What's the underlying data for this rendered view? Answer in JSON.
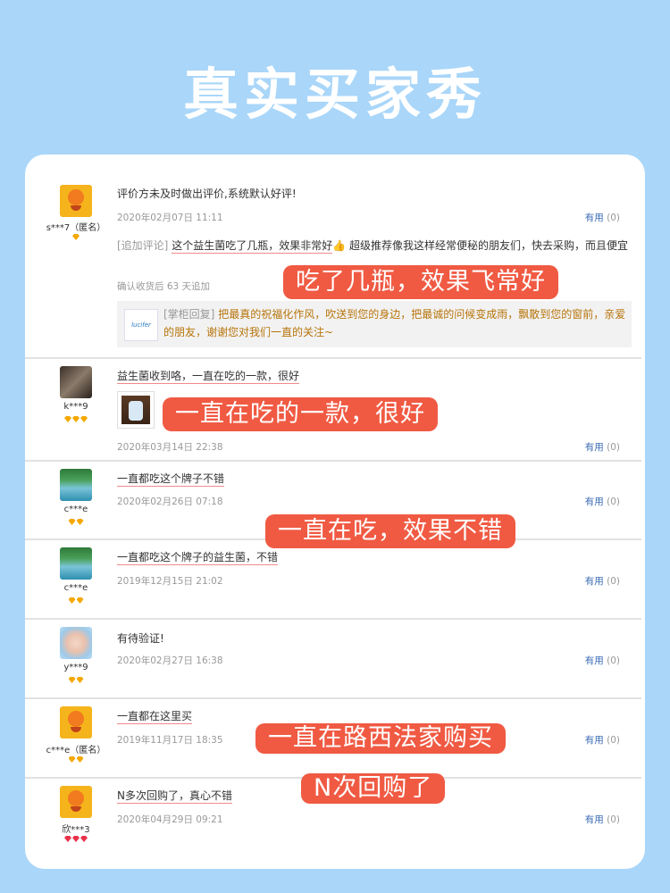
{
  "page": {
    "title": "真实买家秀"
  },
  "reviews": [
    {
      "user": "s***7（匿名）",
      "text": "评价方未及时做出评价,系统默认好评!",
      "date": "2020年02月07日 11:11",
      "useful_label": "有用",
      "useful_count": "(0)",
      "append_tag": "[追加评论]",
      "append_text_underlined": "这个益生菌吃了几瓶，效果非常好",
      "append_text_rest": "超级推荐像我这样经常便秘的朋友们，快去采购，而且便宜",
      "append_meta": "确认收货后 63 天追加",
      "reply_tag": "[掌柜回复]",
      "reply_text": "把最真的祝福化作风，吹送到您的身边，把最诚的问候变成雨，飘散到您的窗前，亲爱的朋友，谢谢您对我们一直的关注~",
      "reply_logo": "lucifer",
      "rank_icons": "gold-gem"
    },
    {
      "user": "k***9",
      "text": "益生菌收到咯，一直在吃的一款，很好",
      "date": "2020年03月14日 22:38",
      "useful_label": "有用",
      "useful_count": "(0)"
    },
    {
      "user": "c***e",
      "text": "一直都吃这个牌子不错",
      "date": "2020年02月26日 07:18",
      "useful_label": "有用",
      "useful_count": "(0)"
    },
    {
      "user": "c***e",
      "text": "一直都吃这个牌子的益生菌，不错",
      "date": "2019年12月15日 21:02",
      "useful_label": "有用",
      "useful_count": "(0)"
    },
    {
      "user": "y***9",
      "text": "有待验证!",
      "date": "2020年02月27日 16:38",
      "useful_label": "有用",
      "useful_count": "(0)"
    },
    {
      "user": "c***e（匿名）",
      "text": "一直都在这里买",
      "date": "2019年11月17日 18:35",
      "useful_label": "有用",
      "useful_count": "(0)"
    },
    {
      "user": "欣***3",
      "text": "N多次回购了，真心不错",
      "date": "2020年04月29日 09:21",
      "useful_label": "有用",
      "useful_count": "(0)",
      "rank_icons": "red-gem"
    }
  ],
  "callouts": {
    "c1": "吃了几瓶，效果飞常好",
    "c2": "一直在吃的一款，很好",
    "c3": "一直在吃，效果不错",
    "c4": "一直在路西法家购买",
    "c5": "N次回购了"
  },
  "colors": {
    "background": "#a9d6f9",
    "callout": "#f05a43",
    "useful_link": "#3a6bb5",
    "reply_text": "#b7740a"
  }
}
